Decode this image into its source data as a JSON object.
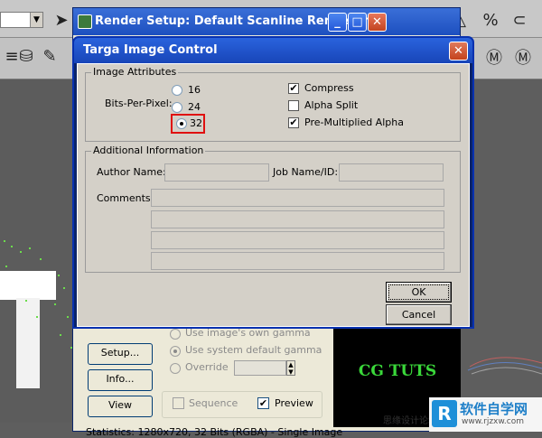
{
  "background": {
    "status_text": "Statistics:  1280x720, 32 Bits (RGBA) - Single Image",
    "watermark": "思缘设计论坛",
    "logo": {
      "text": "软件自学网",
      "url": "www.rjzxw.com"
    }
  },
  "render_setup": {
    "title": "Render Setup: Default Scanline Renderer",
    "buttons": {
      "setup": "Setup...",
      "info": "Info...",
      "view": "View"
    },
    "gamma": {
      "own": "Use image's own gamma",
      "system": "Use system default gamma",
      "override": "Override",
      "selected": "Use system default gamma"
    },
    "sequence_label": "Sequence",
    "sequence_checked": false,
    "preview_label": "Preview",
    "preview_checked": true,
    "preview_text": "CG TUTS"
  },
  "targa": {
    "title": "Targa Image Control",
    "image_attributes": {
      "group_title": "Image Attributes",
      "bpp_label": "Bits-Per-Pixel:",
      "options": [
        "16",
        "24",
        "32"
      ],
      "selected": "32",
      "checkboxes": [
        {
          "label": "Compress",
          "checked": true
        },
        {
          "label": "Alpha Split",
          "checked": false
        },
        {
          "label": "Pre-Multiplied Alpha",
          "checked": true
        }
      ]
    },
    "additional_info": {
      "group_title": "Additional Information",
      "author_label": "Author Name:",
      "author_value": "",
      "job_label": "Job Name/ID:",
      "job_value": "",
      "comments_label": "Comments:",
      "comments": [
        "",
        "",
        "",
        ""
      ]
    },
    "ok_label": "OK",
    "cancel_label": "Cancel"
  },
  "colors": {
    "xp_title_blue": "#1d4fbf",
    "dialog_bg": "#d4d0c8",
    "highlight_red": "#e01010",
    "preview_green": "#3ad83a"
  }
}
